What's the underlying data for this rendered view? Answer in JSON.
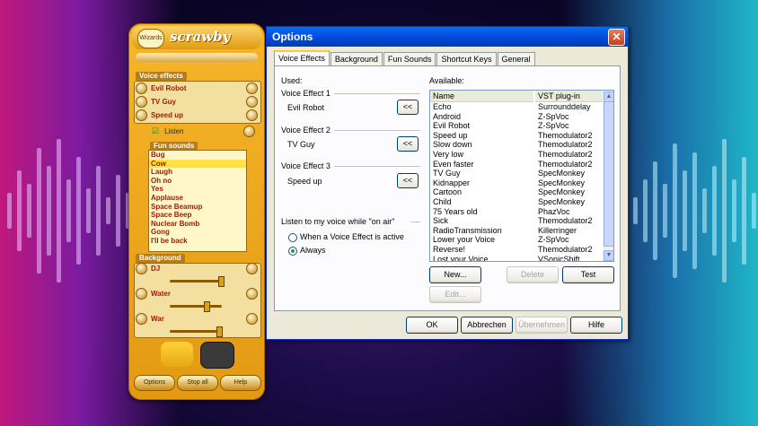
{
  "scrawby": {
    "logo_text": "Wizards",
    "title": "scrawby",
    "voice_effects_label": "Voice effects",
    "voice_effects": [
      "Evil Robot",
      "TV Guy",
      "Speed up"
    ],
    "listen_label": "Listen",
    "fun_sounds_label": "Fun sounds",
    "fun_sounds": [
      "Bug",
      "Cow",
      "Laugh",
      "Oh no",
      "Yes",
      "Applause",
      "Space Beamup",
      "Space Beep",
      "Nuclear Bomb",
      "Gong",
      "I'll be back"
    ],
    "selected_fun_sound": "Cow",
    "background_label": "Background",
    "background_items": [
      "DJ",
      "Water",
      "War"
    ],
    "options_button": "Options",
    "stop_button": "Stop all",
    "help_button": "Help"
  },
  "dialog": {
    "title": "Options",
    "close_symbol": "✕",
    "tabs": [
      "Voice Effects",
      "Background",
      "Fun Sounds",
      "Shortcut Keys",
      "General"
    ],
    "used_label": "Used:",
    "voice_effect_slots": [
      {
        "label": "Voice Effect 1",
        "value": "Evil Robot"
      },
      {
        "label": "Voice Effect 2",
        "value": "TV Guy"
      },
      {
        "label": "Voice Effect 3",
        "value": "Speed up"
      }
    ],
    "assign_symbol": "<<",
    "listen_label": "Listen to my voice while \"on air\"",
    "listen_options": [
      "When a Voice Effect is active",
      "Always"
    ],
    "listen_selected": "Always",
    "available_label": "Available:",
    "columns": [
      "Name",
      "VST plug-in"
    ],
    "available": [
      [
        "Echo",
        "Surrounddelay"
      ],
      [
        "Android",
        "Z-SpVoc"
      ],
      [
        "Evil Robot",
        "Z-SpVoc"
      ],
      [
        "Speed up",
        "Themodulator2"
      ],
      [
        "Slow down",
        "Themodulator2"
      ],
      [
        "Very low",
        "Themodulator2"
      ],
      [
        "Even faster",
        "Themodulator2"
      ],
      [
        "TV Guy",
        "SpecMonkey"
      ],
      [
        "Kidnapper",
        "SpecMonkey"
      ],
      [
        "Cartoon",
        "SpecMonkey"
      ],
      [
        "Child",
        "SpecMonkey"
      ],
      [
        "75 Years old",
        "PhazVoc"
      ],
      [
        "Sick",
        "Themodulator2"
      ],
      [
        "RadioTransmission",
        "Killerringer"
      ],
      [
        "Lower your Voice",
        "Z-SpVoc"
      ],
      [
        "Reverse!",
        "Themodulator2"
      ],
      [
        "Lost your Voice",
        "VSonicShift"
      ]
    ],
    "new_button": "New...",
    "delete_button": "Delete",
    "test_button": "Test",
    "edit_button": "Edit...",
    "ok_button": "OK",
    "cancel_button": "Abbrechen",
    "apply_button": "Übernehmen",
    "help_button": "Hilfe"
  }
}
